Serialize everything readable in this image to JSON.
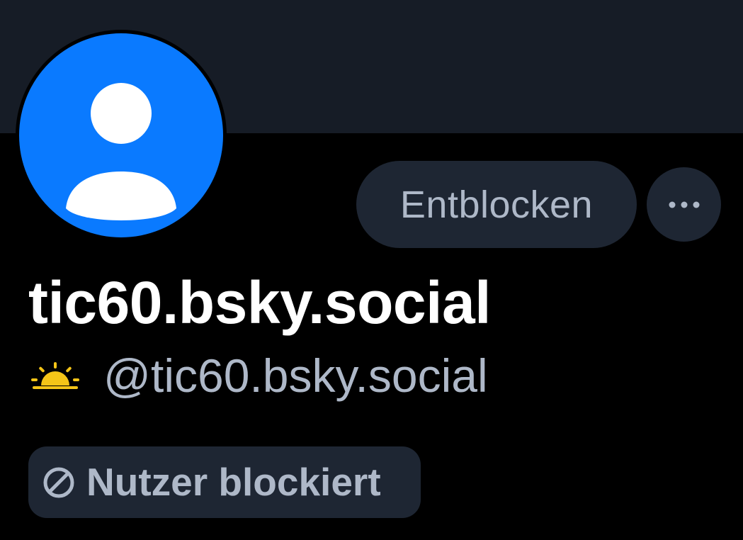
{
  "profile": {
    "display_name": "tic60.bsky.social",
    "handle": "@tic60.bsky.social",
    "status_label": "Nutzer blockiert"
  },
  "actions": {
    "unblock_label": "Entblocken",
    "more_icon": "ellipsis-icon"
  },
  "icons": {
    "avatar": "default-avatar-icon",
    "handle_prefix": "sunrise-icon",
    "status": "blocked-icon"
  },
  "colors": {
    "banner": "#161c26",
    "background": "#000000",
    "avatar": "#0a7aff",
    "pill": "#1e2633",
    "muted_text": "#aeb8c8",
    "sun": "#f5c518"
  }
}
